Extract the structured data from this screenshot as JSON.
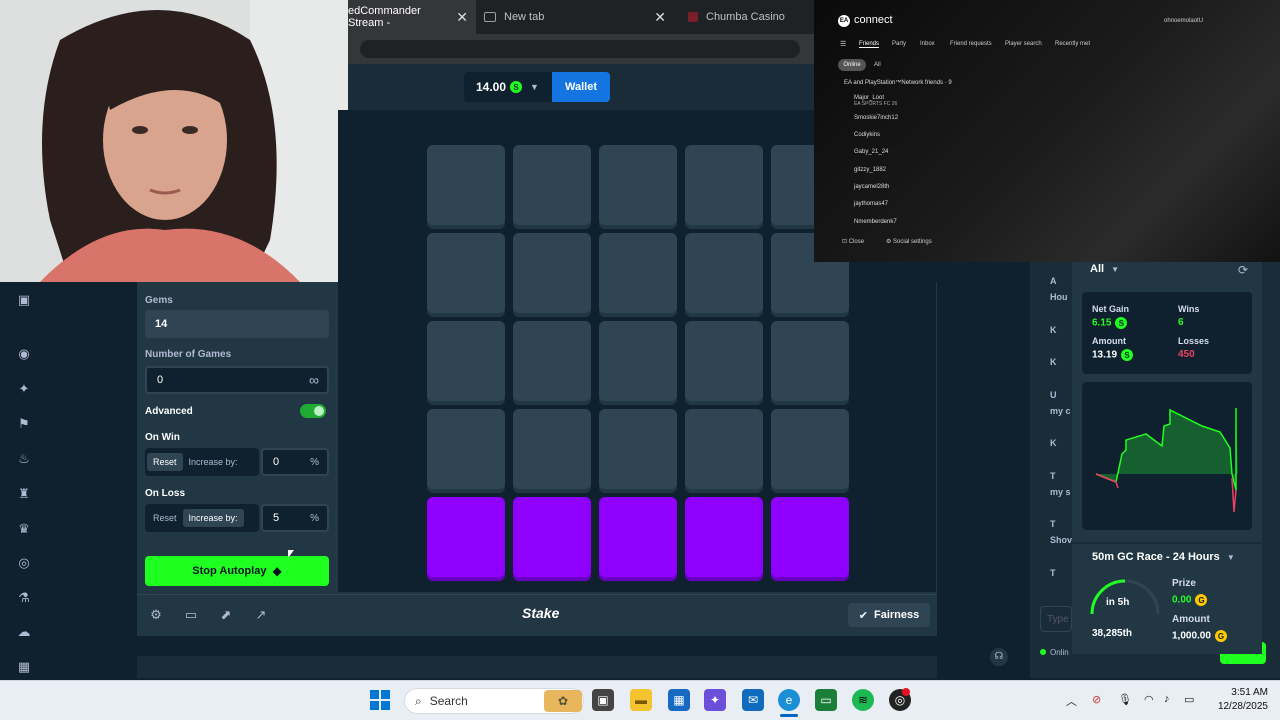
{
  "browser": {
    "tabs": [
      {
        "label": "edCommander Stream -",
        "active": true
      },
      {
        "label": "New tab",
        "active": false
      },
      {
        "label": "Chumba Casino",
        "active": false
      }
    ]
  },
  "topnav": {
    "balance": "14.00",
    "currency_icon": "S",
    "wallet_label": "Wallet"
  },
  "controls": {
    "gems_label": "Gems",
    "gems_value": "14",
    "num_games_label": "Number of Games",
    "num_games_value": "0",
    "infinity_symbol": "∞",
    "advanced_label": "Advanced",
    "on_win_label": "On Win",
    "on_win_reset": "Reset",
    "on_win_increase": "Increase by:",
    "on_win_value": "0",
    "on_loss_label": "On Loss",
    "on_loss_reset": "Reset",
    "on_loss_increase": "Increase by:",
    "on_loss_value": "5",
    "percent": "%",
    "stop_autoplay": "Stop Autoplay"
  },
  "board": {
    "rows": 5,
    "cols": 5,
    "purple_row": 4
  },
  "bottom": {
    "logo": "Stake",
    "fairness": "Fairness"
  },
  "stats": {
    "filter": "All",
    "net_gain_label": "Net Gain",
    "net_gain_value": "6.15",
    "wins_label": "Wins",
    "wins_value": "6",
    "amount_label": "Amount",
    "amount_value": "13.19",
    "losses_label": "Losses",
    "losses_value": "450",
    "colors": {
      "gain": "#1fff20",
      "loss": "#ed4163"
    }
  },
  "race": {
    "title": "50m GC Race - 24 Hours",
    "timer": "in 5h",
    "position": "38,285th",
    "prize_label": "Prize",
    "prize_value": "0.00",
    "amount_label": "Amount",
    "amount_value": "1,000.00",
    "gc_icon": "G"
  },
  "chat": {
    "rows": [
      "A",
      "Hou",
      "K",
      "K",
      "U",
      "my c",
      "K",
      "T",
      "my s",
      "T",
      "Shov",
      "T"
    ],
    "type_placeholder": "Type",
    "online": "Onlin"
  },
  "ea": {
    "title": "connect",
    "user": "ohnoemolaotU",
    "tabs": [
      "Friends",
      "Party",
      "Inbox",
      "Friend requests",
      "Player search",
      "Recently met"
    ],
    "filters": [
      "Online",
      "All"
    ],
    "group_header": "EA and PlayStation™Network friends · 9",
    "friends": [
      {
        "name": "Major_Loot",
        "sub": "EA SPORTS FC 26"
      },
      {
        "name": "Smoskie7inch12",
        "sub": ""
      },
      {
        "name": "Codiykins",
        "sub": ""
      },
      {
        "name": "Gaby_21_24",
        "sub": ""
      },
      {
        "name": "gitzzy_1882",
        "sub": ""
      },
      {
        "name": "jaycamel28th",
        "sub": ""
      },
      {
        "name": "jaythomas47",
        "sub": ""
      },
      {
        "name": "Nmemberdenk7",
        "sub": ""
      }
    ],
    "close_label": "Close",
    "social_settings_label": "Social settings"
  },
  "taskbar": {
    "search_placeholder": "Search",
    "time": "3:51 AM",
    "date": "12/28/2025"
  }
}
